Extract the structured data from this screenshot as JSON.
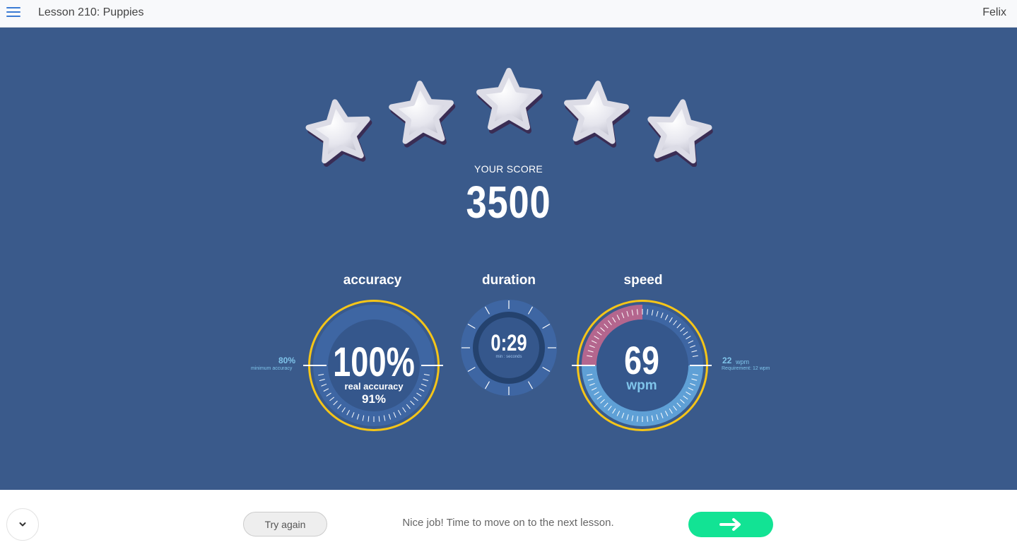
{
  "header": {
    "lesson_title": "Lesson 210: Puppies",
    "user_name": "Felix",
    "menu_icon": "hamburger-icon"
  },
  "result": {
    "stars_earned": 5,
    "stars_total": 5,
    "score_label": "YOUR SCORE",
    "score_value": "3500"
  },
  "gauges": {
    "accuracy": {
      "title": "accuracy",
      "value": "100%",
      "sub_label": "real accuracy",
      "sub_value": "91%",
      "side_value": "80%",
      "side_label": "minimum accuracy"
    },
    "duration": {
      "title": "duration",
      "value": "0:29",
      "unit": "min : seconds"
    },
    "speed": {
      "title": "speed",
      "value": "69",
      "unit": "wpm",
      "side_value": "22",
      "side_unit": "wpm",
      "side_label": "Requirement: 12 wpm"
    }
  },
  "footer": {
    "collapse_icon": "chevron-down-icon",
    "try_again_label": "Try again",
    "message": "Nice job! Time to move on to the next lesson.",
    "next_icon": "arrow-right-icon"
  },
  "colors": {
    "accent_blue": "#3b7bd4",
    "main_background": "#3a5a8b",
    "ring_gold": "#f5c518",
    "text_cyan": "#7fc4ea",
    "speed_pink": "#b4668e",
    "next_green": "#12e394"
  }
}
